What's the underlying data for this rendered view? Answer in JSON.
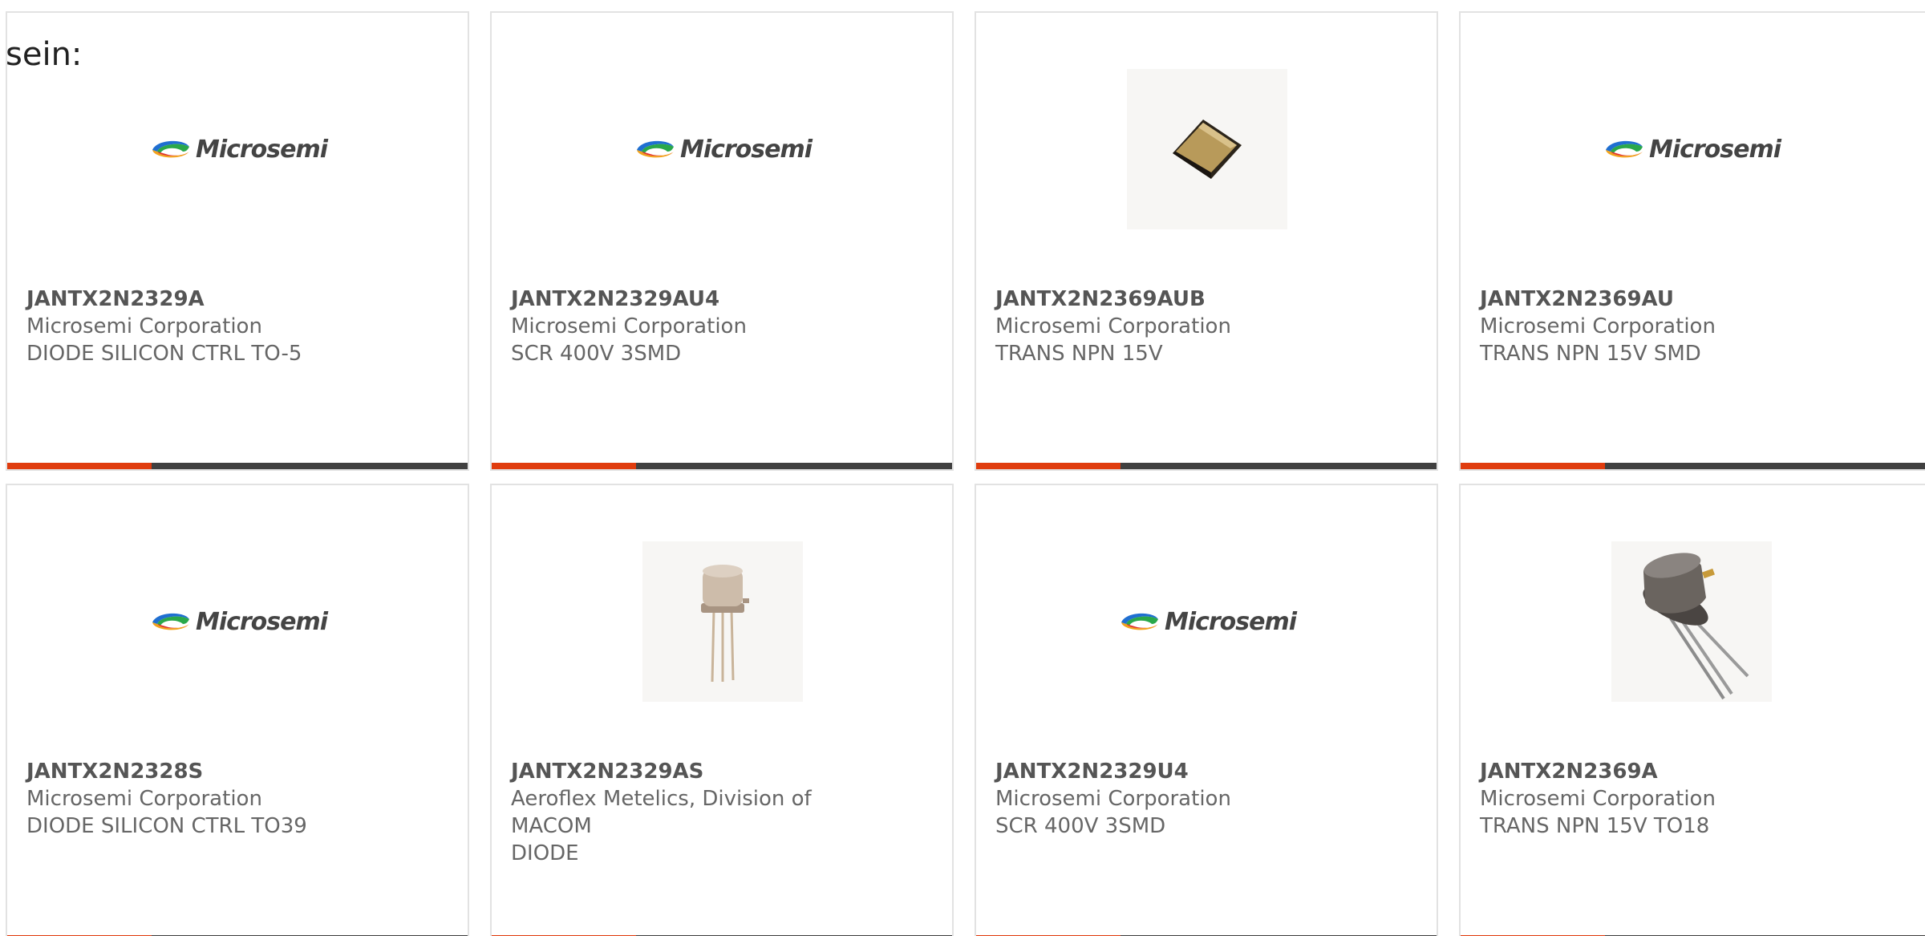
{
  "intro_text": "sein:",
  "logo_text": "Microsemi",
  "colors": {
    "accent": "#e03c0e",
    "bar": "#404040",
    "border": "#e2e2e2",
    "text": "#666666"
  },
  "products": [
    {
      "part": "JANTX2N2329A",
      "maker": "Microsemi Corporation",
      "desc": "DIODE SILICON CTRL TO-5",
      "image": "microsemi-logo"
    },
    {
      "part": "JANTX2N2329AU4",
      "maker": "Microsemi Corporation",
      "desc": "SCR 400V 3SMD",
      "image": "microsemi-logo"
    },
    {
      "part": "JANTX2N2369AUB",
      "maker": "Microsemi Corporation",
      "desc": "TRANS NPN 15V",
      "image": "smd-package-photo"
    },
    {
      "part": "JANTX2N2369AU",
      "maker": "Microsemi Corporation",
      "desc": "TRANS NPN 15V SMD",
      "image": "microsemi-logo"
    },
    {
      "part": "JANTX2N2328S",
      "maker": "Microsemi Corporation",
      "desc": "DIODE SILICON CTRL TO39",
      "image": "microsemi-logo"
    },
    {
      "part": "JANTX2N2329AS",
      "maker": "Aeroflex Metelics, Division of",
      "maker2": "MACOM",
      "desc": "DIODE",
      "image": "to-can-photo"
    },
    {
      "part": "JANTX2N2329U4",
      "maker": "Microsemi Corporation",
      "desc": "SCR 400V 3SMD",
      "image": "microsemi-logo"
    },
    {
      "part": "JANTX2N2369A",
      "maker": "Microsemi Corporation",
      "desc": "TRANS NPN 15V TO18",
      "image": "to18-photo"
    }
  ]
}
